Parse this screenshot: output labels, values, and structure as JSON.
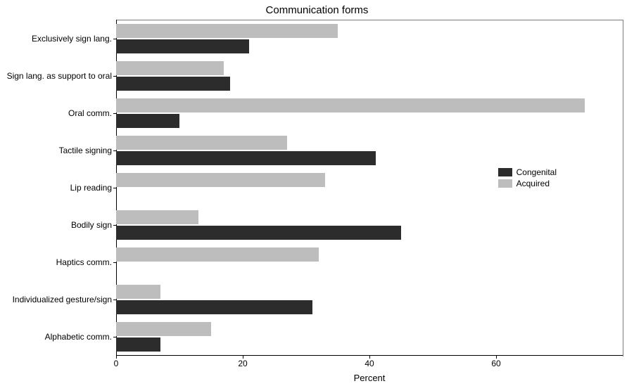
{
  "chart_data": {
    "type": "bar",
    "title": "Communication forms",
    "xlabel": "Percent",
    "ylabel": "",
    "xlim": [
      0,
      80
    ],
    "xticks": [
      0,
      20,
      40,
      60
    ],
    "categories": [
      "Exclusively sign lang.",
      "Sign lang. as support to oral",
      "Oral comm.",
      "Tactile signing",
      "Lip reading",
      "Bodily sign",
      "Haptics comm.",
      "Individualized gesture/sign",
      "Alphabetic comm."
    ],
    "series": [
      {
        "name": "Congenital",
        "color": "#2c2c2c",
        "values": [
          21,
          18,
          10,
          41,
          0,
          45,
          0,
          31,
          7
        ]
      },
      {
        "name": "Acquired",
        "color": "#bdbdbd",
        "values": [
          35,
          17,
          74,
          27,
          33,
          13,
          32,
          7,
          15
        ]
      }
    ],
    "legend_position": "right"
  }
}
